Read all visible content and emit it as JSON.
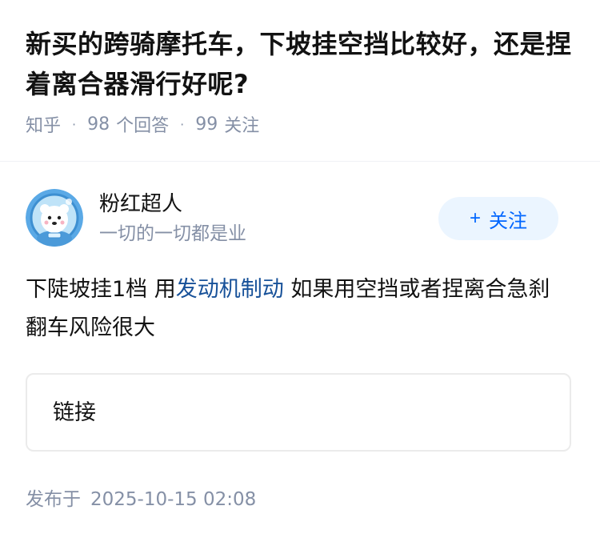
{
  "question": {
    "title": "新买的跨骑摩托车，下坡挂空挡比较好，还是捏着离合器滑行好呢?",
    "source": "知乎",
    "answers_count": "98",
    "answers_label": "个回答",
    "followers_count": "99",
    "followers_label": "关注"
  },
  "author": {
    "name": "粉红超人",
    "bio": "一切的一切都是业",
    "follow_plus": "+",
    "follow_label": "关注"
  },
  "answer": {
    "text_before": "下陡坡挂1档 用",
    "link_text": "发动机制动",
    "text_after": " 如果用空挡或者捏离合急刹 翻车风险很大"
  },
  "link_card": {
    "label": "链接"
  },
  "published": {
    "label": "发布于",
    "date": "2025-10-15 02:08"
  },
  "colors": {
    "accent": "#0066ff",
    "link": "#175199",
    "muted": "#8590a6",
    "follow_bg": "#ebf5ff"
  }
}
